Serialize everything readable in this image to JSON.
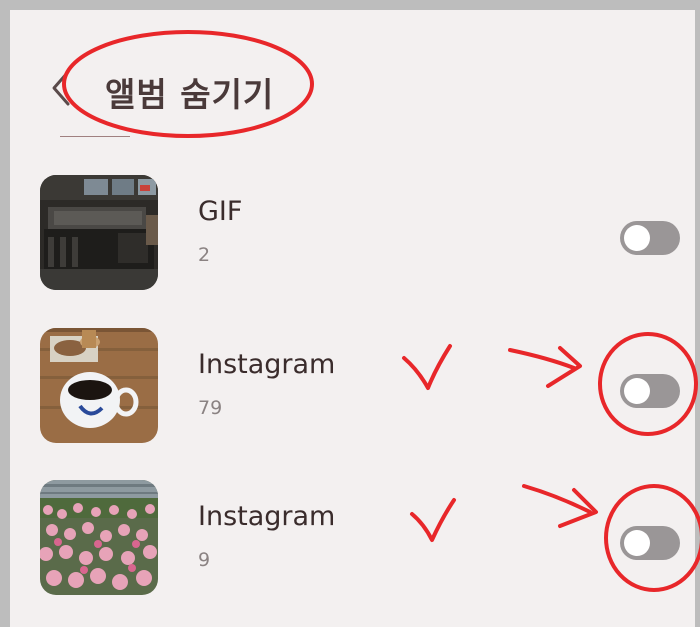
{
  "header": {
    "title": "앨범 숨기기",
    "back_icon": "chevron-left-icon"
  },
  "albums": [
    {
      "name": "GIF",
      "count": "2",
      "hidden": false
    },
    {
      "name": "Instagram",
      "count": "79",
      "hidden": false
    },
    {
      "name": "Instagram",
      "count": "9",
      "hidden": false
    }
  ],
  "colors": {
    "background": "#f3f0f0",
    "toggle_off": "#9a9697",
    "annotation_red": "#e8272a"
  }
}
